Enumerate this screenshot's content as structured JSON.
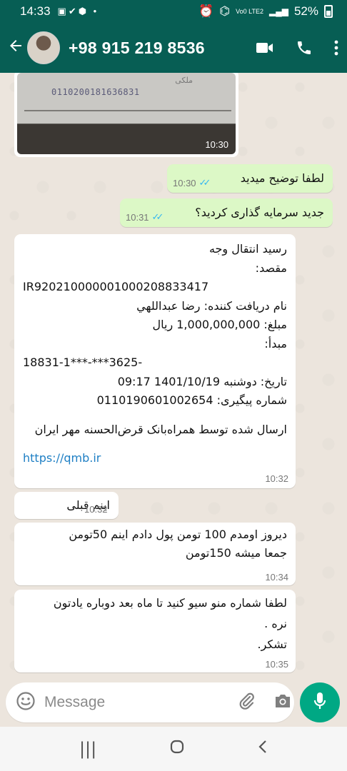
{
  "status_bar": {
    "time": "14:33",
    "battery": "52%",
    "network": "Vo0 LTE2"
  },
  "header": {
    "contact_name": "+98 915 219 8536"
  },
  "image_message": {
    "doc_number": "0110200181636831",
    "time": "10:30"
  },
  "messages": [
    {
      "id": "out1",
      "direction": "outgoing",
      "text": "لطفا توضیح میدید",
      "time": "10:30",
      "status": "read"
    },
    {
      "id": "out2",
      "direction": "outgoing",
      "text": "جدید سرمایه گذاری کردید؟",
      "time": "10:31",
      "status": "read"
    },
    {
      "id": "in1",
      "direction": "incoming",
      "lines": [
        "رسید انتقال وجه",
        "مقصد:",
        "IR920210000001000208833417",
        "نام دریافت کننده: رضا عبداللهي",
        "مبلغ: 1,000,000,000 ریال",
        "مبدأ:",
        "18831-1***-***3625-",
        "تاریخ: دوشنبه 1401/10/19  09:17",
        "شماره پیگیری: 0110190601002654",
        "ارسال شده توسط همراه‌بانک قرض‌الحسنه مهر ایران",
        "https://qmb.ir"
      ],
      "time": "10:32"
    },
    {
      "id": "in2",
      "direction": "incoming",
      "text": "اینم قبلی",
      "time": "10:32"
    },
    {
      "id": "in3",
      "direction": "incoming",
      "lines": [
        "دیروز اومدم 100 تومن پول دادم اینم 50تومن",
        "جمعا میشه 150تومن"
      ],
      "time": "10:34"
    },
    {
      "id": "in4",
      "direction": "incoming",
      "lines": [
        "لطفا شماره منو سیو کنید تا ماه بعد دوباره یادتون",
        "نره .",
        "تشکر."
      ],
      "time": "10:35"
    }
  ],
  "composer": {
    "placeholder": "Message"
  },
  "colors": {
    "header": "#075e54",
    "outgoing_bubble": "#dcf8c6",
    "incoming_bubble": "#ffffff",
    "accent": "#00a884",
    "read_ticks": "#34b7f1",
    "link": "#1e7fc4"
  }
}
